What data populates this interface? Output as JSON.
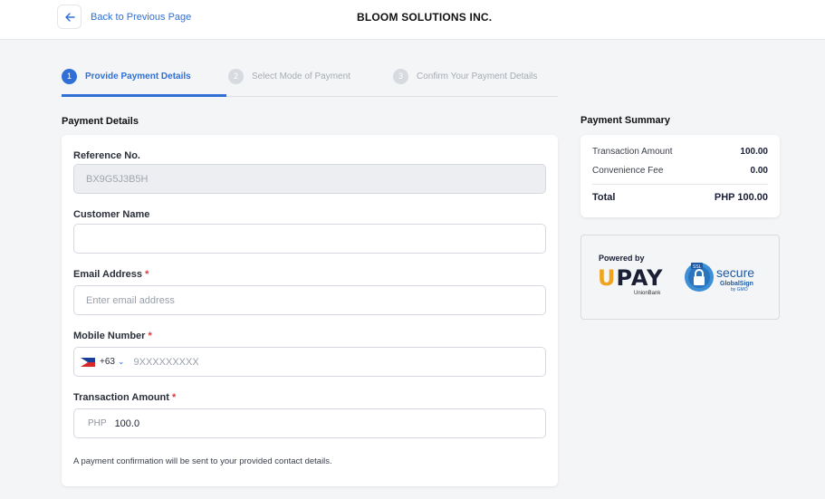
{
  "header": {
    "back_label": "Back to Previous Page",
    "company": "BLOOM SOLUTIONS INC."
  },
  "steps": [
    {
      "num": "1",
      "label": "Provide Payment Details",
      "state": "active"
    },
    {
      "num": "2",
      "label": "Select Mode of Payment",
      "state": "inactive"
    },
    {
      "num": "3",
      "label": "Confirm Your Payment Details",
      "state": "inactive"
    }
  ],
  "payment_details": {
    "title": "Payment Details",
    "reference": {
      "label": "Reference No.",
      "value": "BX9G5J3B5H"
    },
    "customer_name": {
      "label": "Customer Name",
      "value": ""
    },
    "email": {
      "label": "Email Address",
      "required_mark": "*",
      "placeholder": "Enter email address",
      "value": ""
    },
    "mobile": {
      "label": "Mobile Number",
      "required_mark": "*",
      "country_code": "+63",
      "placeholder": "9XXXXXXXXX",
      "value": ""
    },
    "amount": {
      "label": "Transaction Amount",
      "required_mark": "*",
      "currency": "PHP",
      "value": "100.0"
    },
    "note": "A payment confirmation will be sent to your provided contact details."
  },
  "summary": {
    "title": "Payment Summary",
    "rows": [
      {
        "label": "Transaction Amount",
        "value": "100.00"
      },
      {
        "label": "Convenience Fee",
        "value": "0.00"
      }
    ],
    "total_label": "Total",
    "total_value": "PHP 100.00"
  },
  "powered": {
    "powered_by": "Powered by",
    "brand_u": "U",
    "brand_rest": "PAY",
    "brand_sub": "UnionBank",
    "secure_text": "secure",
    "secure_sub": "GlobalSign",
    "secure_sub2": "by GMO",
    "ssl_text": "SSL"
  },
  "colors": {
    "accent": "#2f6fd6",
    "required": "#d93a3a",
    "upay_orange": "#f0a31c"
  }
}
